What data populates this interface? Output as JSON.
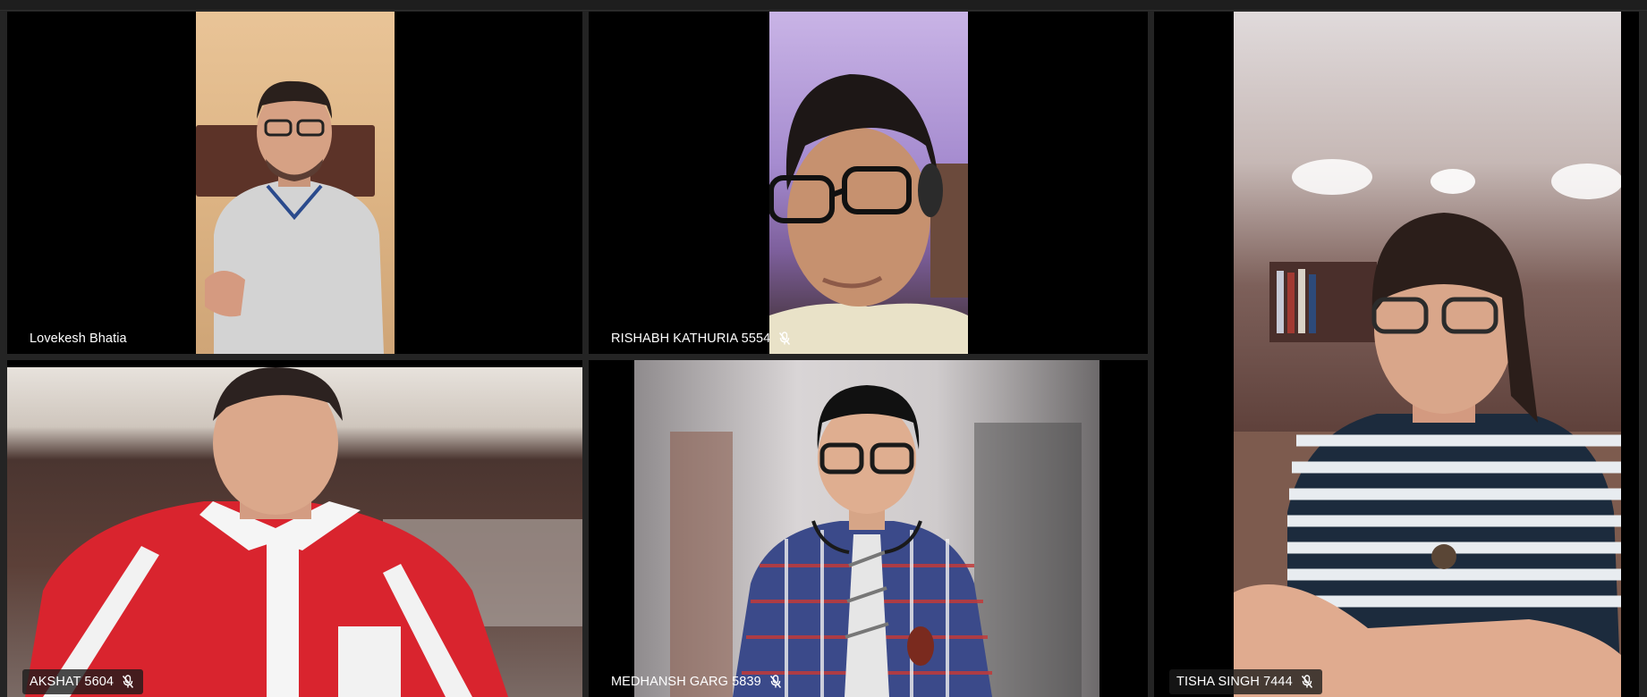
{
  "participants": [
    {
      "name": "Lovekesh Bhatia",
      "muted": false
    },
    {
      "name": "RISHABH KATHURIA 5554",
      "muted": true
    },
    {
      "name": "TISHA SINGH 7444",
      "muted": true
    },
    {
      "name": "AKSHAT 5604",
      "muted": true
    },
    {
      "name": "MEDHANSH GARG 5839",
      "muted": true
    }
  ],
  "icons": {
    "mute": "microphone-muted-icon"
  }
}
